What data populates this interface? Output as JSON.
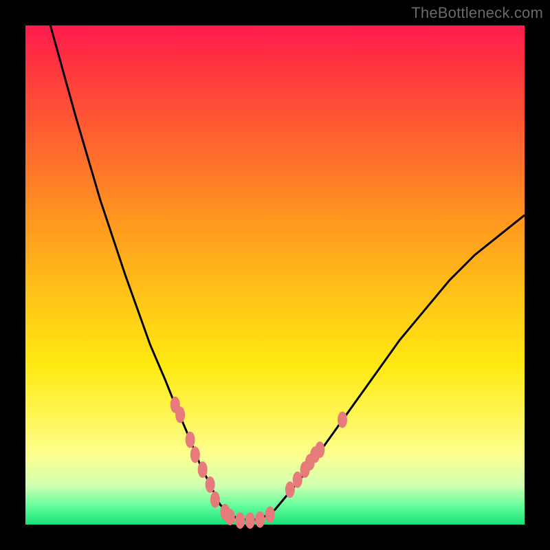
{
  "watermark": "TheBottleneck.com",
  "colors": {
    "frame": "#000000",
    "grad_top": "#ff1a4d",
    "grad_mid": "#ffe912",
    "grad_bot": "#16e27a",
    "curve": "#000000",
    "points": "#e77a7a"
  },
  "chart_data": {
    "type": "line",
    "title": "",
    "xlabel": "",
    "ylabel": "",
    "xlim": [
      0,
      100
    ],
    "ylim": [
      0,
      100
    ],
    "grid": false,
    "legend": "none",
    "series": [
      {
        "name": "bottleneck-curve",
        "x": [
          5,
          10,
          15,
          20,
          25,
          28,
          30,
          33,
          35,
          37,
          39,
          41,
          43,
          47,
          50,
          55,
          60,
          65,
          70,
          75,
          80,
          85,
          90,
          95,
          100
        ],
        "y": [
          100,
          82,
          65,
          50,
          36,
          29,
          24,
          17,
          12,
          8,
          4,
          2,
          1,
          1,
          3,
          9,
          16,
          23,
          30,
          37,
          43,
          49,
          54,
          58,
          62
        ]
      }
    ],
    "points": [
      {
        "x": 30,
        "y": 24
      },
      {
        "x": 31,
        "y": 22
      },
      {
        "x": 33,
        "y": 17
      },
      {
        "x": 34,
        "y": 14
      },
      {
        "x": 35.5,
        "y": 11
      },
      {
        "x": 37,
        "y": 8
      },
      {
        "x": 38,
        "y": 5
      },
      {
        "x": 40,
        "y": 2.5
      },
      {
        "x": 41,
        "y": 1.5
      },
      {
        "x": 43,
        "y": 0.8
      },
      {
        "x": 45,
        "y": 0.8
      },
      {
        "x": 47,
        "y": 1
      },
      {
        "x": 49,
        "y": 2
      },
      {
        "x": 53,
        "y": 7
      },
      {
        "x": 54.5,
        "y": 9
      },
      {
        "x": 56,
        "y": 11
      },
      {
        "x": 57,
        "y": 12.5
      },
      {
        "x": 58,
        "y": 14
      },
      {
        "x": 59,
        "y": 15
      },
      {
        "x": 63.5,
        "y": 21
      }
    ]
  }
}
